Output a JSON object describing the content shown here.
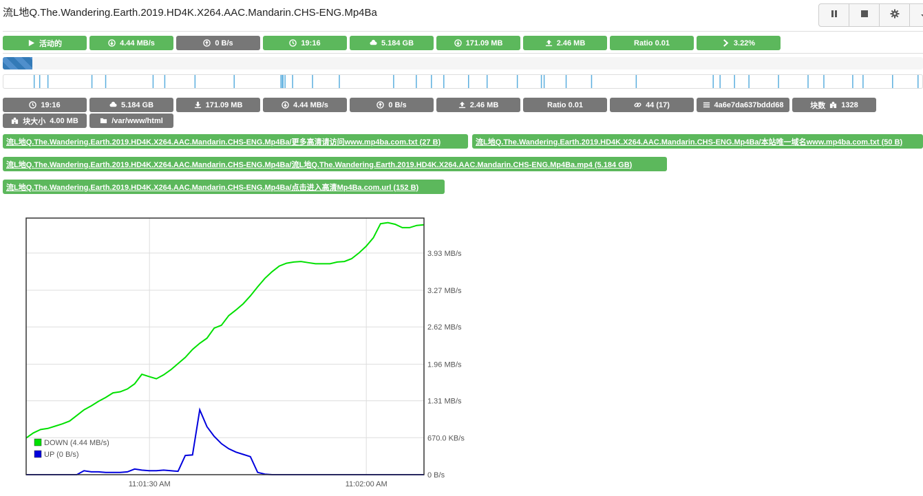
{
  "title": "流L地Q.The.Wandering.Earth.2019.HD4K.X264.AAC.Mandarin.CHS-ENG.Mp4Ba",
  "controls": [
    {
      "name": "pause-button",
      "icon": "pause-icon"
    },
    {
      "name": "stop-button",
      "icon": "stop-icon"
    },
    {
      "name": "settings-button",
      "icon": "gear-icon"
    },
    {
      "name": "dropdown-button",
      "icon": "caret-down-icon"
    }
  ],
  "status_badges": [
    {
      "icon": "play-icon",
      "label": "活动的",
      "color": "green"
    },
    {
      "icon": "download-circle-icon",
      "label": "4.44 MB/s",
      "color": "green"
    },
    {
      "icon": "upload-circle-icon",
      "label": "0 B/s",
      "color": "gray"
    },
    {
      "icon": "clock-icon",
      "label": "19:16",
      "color": "green"
    },
    {
      "icon": "cloud-download-icon",
      "label": "5.184 GB",
      "color": "green"
    },
    {
      "icon": "download-circle-icon",
      "label": "171.09 MB",
      "color": "green"
    },
    {
      "icon": "upload-icon",
      "label": "2.46 MB",
      "color": "green"
    },
    {
      "icon": "",
      "label": "Ratio 0.01",
      "color": "green"
    },
    {
      "icon": "chevron-right-icon",
      "label": "3.22%",
      "color": "green"
    }
  ],
  "progress_percent": 3.22,
  "info_badges": [
    {
      "icon": "clock-icon",
      "label": "19:16"
    },
    {
      "icon": "cloud-download-icon",
      "label": "5.184 GB"
    },
    {
      "icon": "download-icon",
      "label": "171.09 MB"
    },
    {
      "icon": "download-circle-icon",
      "label": "4.44 MB/s"
    },
    {
      "icon": "upload-circle-icon",
      "label": "0 B/s"
    },
    {
      "icon": "upload-icon",
      "label": "2.46 MB"
    },
    {
      "icon": "",
      "label": "Ratio 0.01"
    },
    {
      "icon": "link-icon",
      "label": "44 (17)"
    },
    {
      "icon": "list-icon",
      "label": "4a6e7da637bddd68"
    },
    {
      "icon": "puzzle-icon",
      "label": "块数",
      "label2": "1328"
    }
  ],
  "info_badges_row2": [
    {
      "icon": "puzzle-icon",
      "label": "块大小",
      "label2": "4.00 MB"
    },
    {
      "icon": "folder-icon",
      "label": "/var/www/html"
    }
  ],
  "files": [
    "流L地Q.The.Wandering.Earth.2019.HD4K.X264.AAC.Mandarin.CHS-ENG.Mp4Ba/更多高清请访问www.mp4ba.com.txt (27 B)",
    "流L地Q.The.Wandering.Earth.2019.HD4K.X264.AAC.Mandarin.CHS-ENG.Mp4Ba/本站唯一域名www.mp4ba.com.txt (50 B)",
    "流L地Q.The.Wandering.Earth.2019.HD4K.X264.AAC.Mandarin.CHS-ENG.Mp4Ba/流L地Q.The.Wandering.Earth.2019.HD4K.X264.AAC.Mandarin.CHS-ENG.Mp4Ba.mp4 (5.184 GB)",
    "流L地Q.The.Wandering.Earth.2019.HD4K.X264.AAC.Mandarin.CHS-ENG.Mp4Ba/点击进入高清Mp4Ba.com.url (152 B)"
  ],
  "colors": {
    "green": "#5cb85c",
    "gray": "#777777",
    "down": "#00e000",
    "up": "#0000dd",
    "progress": "#337ab7"
  },
  "chart_data": {
    "type": "line",
    "ylim": [
      0,
      4.55
    ],
    "y_ticks": [
      {
        "value": 0,
        "label": "0 B/s"
      },
      {
        "value": 0.655,
        "label": "670.0 KB/s"
      },
      {
        "value": 1.31,
        "label": "1.31 MB/s"
      },
      {
        "value": 1.96,
        "label": "1.96 MB/s"
      },
      {
        "value": 2.62,
        "label": "2.62 MB/s"
      },
      {
        "value": 3.27,
        "label": "3.27 MB/s"
      },
      {
        "value": 3.93,
        "label": "3.93 MB/s"
      }
    ],
    "x_ticks": [
      {
        "pos": 0.31,
        "label": "11:01:30 AM"
      },
      {
        "pos": 0.855,
        "label": "11:02:00 AM"
      }
    ],
    "grid": true,
    "legend_position": "bottom-left",
    "series": [
      {
        "name": "DOWN (4.44 MB/s)",
        "color": "#00e000",
        "values": [
          0.65,
          0.74,
          0.8,
          0.82,
          0.86,
          0.9,
          0.95,
          1.05,
          1.15,
          1.22,
          1.3,
          1.37,
          1.45,
          1.47,
          1.52,
          1.61,
          1.78,
          1.74,
          1.7,
          1.77,
          1.86,
          1.97,
          2.08,
          2.22,
          2.33,
          2.42,
          2.6,
          2.65,
          2.82,
          2.92,
          3.03,
          3.17,
          3.33,
          3.48,
          3.6,
          3.7,
          3.75,
          3.77,
          3.78,
          3.76,
          3.74,
          3.74,
          3.74,
          3.77,
          3.78,
          3.83,
          3.93,
          4.05,
          4.2,
          4.45,
          4.47,
          4.44,
          4.38,
          4.38,
          4.42,
          4.43
        ]
      },
      {
        "name": "UP (0 B/s)",
        "color": "#0000dd",
        "values": [
          0,
          0,
          0,
          0,
          0,
          0,
          0,
          0,
          0.07,
          0.05,
          0.05,
          0.04,
          0.04,
          0.04,
          0.05,
          0.1,
          0.08,
          0.07,
          0.07,
          0.08,
          0.07,
          0.06,
          0.34,
          0.35,
          1.15,
          0.85,
          0.68,
          0.55,
          0.46,
          0.4,
          0.36,
          0.32,
          0.04,
          0.01,
          0,
          0,
          0,
          0,
          0,
          0,
          0,
          0,
          0,
          0,
          0,
          0,
          0,
          0,
          0,
          0,
          0,
          0,
          0,
          0,
          0,
          0
        ]
      }
    ]
  }
}
